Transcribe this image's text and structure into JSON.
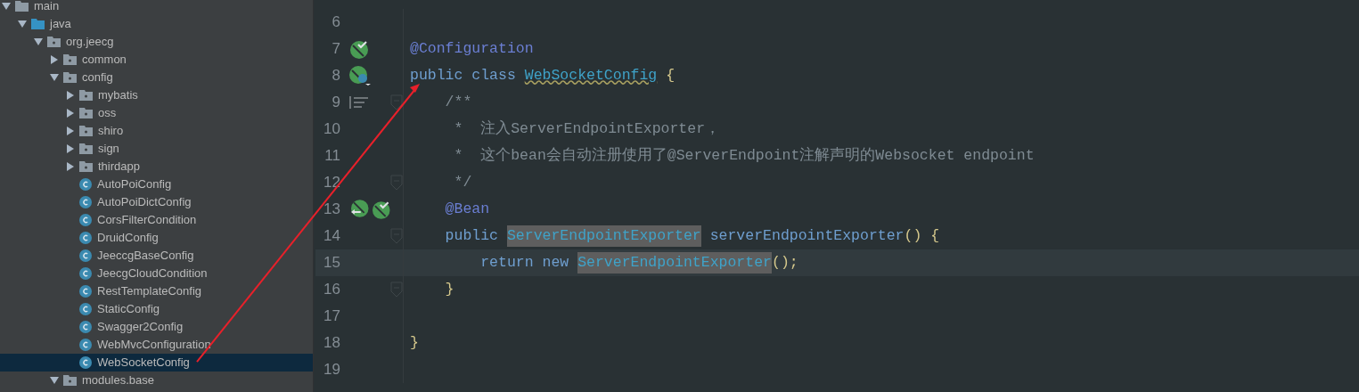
{
  "project_tree": {
    "items": [
      {
        "label": "main",
        "kind": "folder",
        "expanded": true,
        "selected": false,
        "children": [
          {
            "label": "java",
            "kind": "source",
            "expanded": true,
            "selected": false,
            "children": [
              {
                "label": "org.jeecg",
                "kind": "package",
                "expanded": true,
                "selected": false,
                "children": [
                  {
                    "label": "common",
                    "kind": "package",
                    "expanded": false,
                    "selected": false
                  },
                  {
                    "label": "config",
                    "kind": "package",
                    "expanded": true,
                    "selected": false,
                    "children": [
                      {
                        "label": "mybatis",
                        "kind": "package",
                        "expanded": false,
                        "selected": false
                      },
                      {
                        "label": "oss",
                        "kind": "package",
                        "expanded": false,
                        "selected": false
                      },
                      {
                        "label": "shiro",
                        "kind": "package",
                        "expanded": false,
                        "selected": false
                      },
                      {
                        "label": "sign",
                        "kind": "package",
                        "expanded": false,
                        "selected": false
                      },
                      {
                        "label": "thirdapp",
                        "kind": "package",
                        "expanded": false,
                        "selected": false
                      },
                      {
                        "label": "AutoPoiConfig",
                        "kind": "class",
                        "selected": false
                      },
                      {
                        "label": "AutoPoiDictConfig",
                        "kind": "class",
                        "selected": false
                      },
                      {
                        "label": "CorsFilterCondition",
                        "kind": "class",
                        "selected": false
                      },
                      {
                        "label": "DruidConfig",
                        "kind": "class",
                        "selected": false
                      },
                      {
                        "label": "JeeccgBaseConfig",
                        "kind": "class",
                        "selected": false
                      },
                      {
                        "label": "JeecgCloudCondition",
                        "kind": "class",
                        "selected": false
                      },
                      {
                        "label": "RestTemplateConfig",
                        "kind": "class",
                        "selected": false
                      },
                      {
                        "label": "StaticConfig",
                        "kind": "class",
                        "selected": false
                      },
                      {
                        "label": "Swagger2Config",
                        "kind": "class",
                        "selected": false
                      },
                      {
                        "label": "WebMvcConfiguration",
                        "kind": "class",
                        "selected": false
                      },
                      {
                        "label": "WebSocketConfig",
                        "kind": "class",
                        "selected": true
                      }
                    ]
                  },
                  {
                    "label": "modules.base",
                    "kind": "package",
                    "expanded": true,
                    "selected": false
                  }
                ]
              }
            ]
          }
        ]
      }
    ]
  },
  "editor": {
    "lines": [
      {
        "number": "6",
        "current": false,
        "fold": false
      },
      {
        "number": "7",
        "current": false,
        "gutter": [
          {
            "kind": "bean-check"
          }
        ],
        "fold": false,
        "tokens": [
          {
            "text": "@Configuration",
            "kind": "annotation"
          }
        ]
      },
      {
        "number": "8",
        "current": false,
        "gutter": [
          {
            "kind": "bean-class"
          }
        ],
        "fold": false,
        "tokens": [
          {
            "text": "public class ",
            "kind": "keyword"
          },
          {
            "text": "WebSocketConfig",
            "kind": "class-warn"
          },
          {
            "text": " {",
            "kind": "brace"
          }
        ]
      },
      {
        "number": "9",
        "current": false,
        "gutter": [
          {
            "kind": "doc"
          }
        ],
        "fold": true,
        "tokens": [
          {
            "text": "    /**",
            "kind": "comment"
          }
        ]
      },
      {
        "number": "10",
        "current": false,
        "fold": false,
        "tokens": [
          {
            "text": "     *  注入ServerEndpointExporter，",
            "kind": "comment"
          }
        ]
      },
      {
        "number": "11",
        "current": false,
        "fold": false,
        "tokens": [
          {
            "text": "     *  这个bean会自动注册使用了@ServerEndpoint注解声明的Websocket endpoint",
            "kind": "comment"
          }
        ]
      },
      {
        "number": "12",
        "current": false,
        "fold": true,
        "tokens": [
          {
            "text": "     */",
            "kind": "comment"
          }
        ]
      },
      {
        "number": "13",
        "current": false,
        "gutter": [
          {
            "kind": "bean-link"
          },
          {
            "kind": "bean-check"
          }
        ],
        "fold": false,
        "tokens": [
          {
            "text": "    @Bean",
            "kind": "annotation"
          }
        ]
      },
      {
        "number": "14",
        "current": false,
        "fold": true,
        "tokens": [
          {
            "text": "    public ",
            "kind": "keyword"
          },
          {
            "text": "ServerEndpointExporter",
            "kind": "class-hl"
          },
          {
            "text": " serverEndpointExporter",
            "kind": "method"
          },
          {
            "text": "()",
            "kind": "brace"
          },
          {
            "text": " {",
            "kind": "brace"
          }
        ]
      },
      {
        "number": "15",
        "current": true,
        "fold": false,
        "tokens": [
          {
            "text": "        return new ",
            "kind": "keyword"
          },
          {
            "text": "ServerEndpointExporter",
            "kind": "class-hl"
          },
          {
            "text": "();",
            "kind": "brace"
          }
        ]
      },
      {
        "number": "16",
        "current": false,
        "fold": true,
        "tokens": [
          {
            "text": "    }",
            "kind": "brace"
          }
        ]
      },
      {
        "number": "17",
        "current": false,
        "fold": false
      },
      {
        "number": "18",
        "current": false,
        "fold": false,
        "tokens": [
          {
            "text": "}",
            "kind": "brace"
          }
        ]
      },
      {
        "number": "19",
        "current": false,
        "fold": false
      }
    ]
  }
}
